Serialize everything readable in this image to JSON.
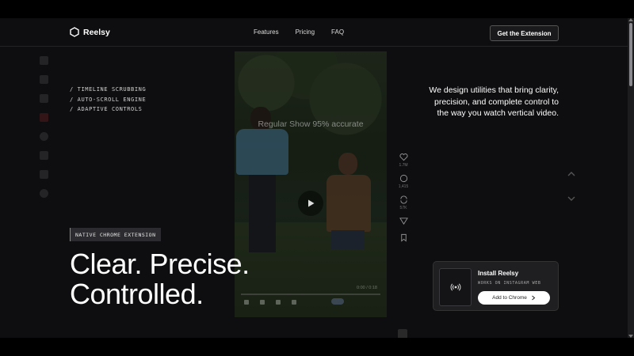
{
  "brand": {
    "name": "Reelsy"
  },
  "nav": {
    "items": [
      "Features",
      "Pricing",
      "FAQ"
    ]
  },
  "header": {
    "cta_label": "Get the Extension"
  },
  "video": {
    "overlay_text": "Regular Show 95% accurate",
    "time": "0:00 / 0:18"
  },
  "rail": {
    "counts": [
      "1.7M",
      "1,415",
      "57K"
    ]
  },
  "hero": {
    "features": [
      "/ TIMELINE SCRUBBING",
      "/ AUTO-SCROLL ENGINE",
      "/ ADAPTIVE CONTROLS"
    ],
    "badge": "NATIVE CHROME EXTENSION",
    "title_line1": "Clear. Precise.",
    "title_line2": "Controlled.",
    "tagline": "We design utilities that bring clarity, precision, and complete control to the way you watch vertical video."
  },
  "install": {
    "title": "Install Reelsy",
    "subtitle": "WORKS ON INSTAGRAM WEB",
    "button_label": "Add to Chrome"
  },
  "colors": {
    "page_bg": "#0e0e10",
    "card_bg": "#1f1f22",
    "accent": "#ffffff"
  },
  "icons": [
    "hexagon-logo-icon",
    "play-icon",
    "heart-icon",
    "comment-icon",
    "repost-icon",
    "send-icon",
    "bookmark-icon",
    "chevron-up-icon",
    "chevron-down-icon",
    "broadcast-icon",
    "chevron-right-icon"
  ]
}
